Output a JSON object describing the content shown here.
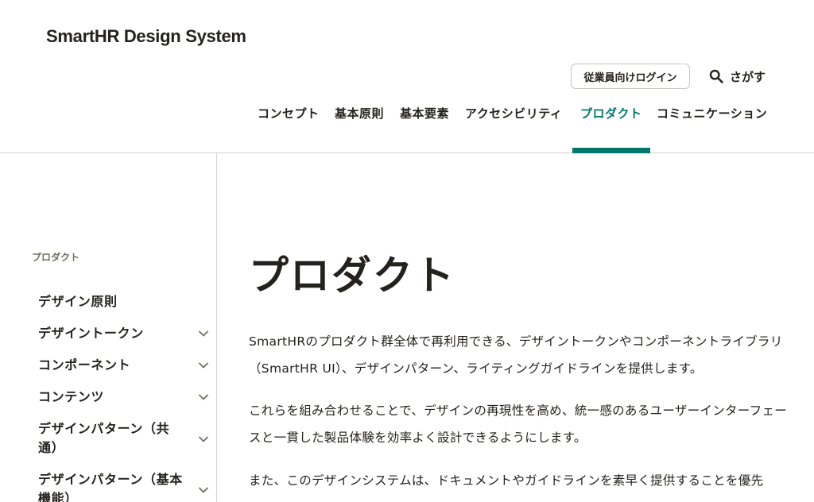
{
  "header": {
    "logo": "SmartHR Design System",
    "login_label": "従業員向けログイン",
    "search_label": "さがす"
  },
  "nav": {
    "items": [
      {
        "label": "コンセプト"
      },
      {
        "label": "基本原則"
      },
      {
        "label": "基本要素"
      },
      {
        "label": "アクセシビリティ"
      },
      {
        "label": "プロダクト"
      },
      {
        "label": "コミュニケーション"
      }
    ],
    "active": "プロダクト"
  },
  "sidebar": {
    "heading": "プロダクト",
    "items": [
      {
        "label": "デザイン原則",
        "expandable": false
      },
      {
        "label": "デザイントークン",
        "expandable": true
      },
      {
        "label": "コンポーネント",
        "expandable": true
      },
      {
        "label": "コンテンツ",
        "expandable": true
      },
      {
        "label": "デザインパターン（共通）",
        "expandable": true
      },
      {
        "label": "デザインパターン（基本機能）",
        "expandable": true
      }
    ]
  },
  "main": {
    "title": "プロダクト",
    "paragraphs": [
      "SmartHRのプロダクト群全体で再利用できる、デザイントークンやコンポーネントライブラリ（SmartHR UI）、デザインパターン、ライティングガイドラインを提供します。",
      "これらを組み合わせることで、デザインの再現性を高め、統一感のあるユーザーインターフェースと一貫した製品体験を効率よく設計できるようにします。",
      "また、このデザインシステムは、ドキュメントやガイドラインを素早く提供することを優先"
    ]
  },
  "colors": {
    "accent": "#00786e",
    "text": "#23221e",
    "muted": "#706d65",
    "border": "#d6d3d0"
  },
  "icons": {
    "search": "search-icon",
    "expand": "chevron-down-icon"
  }
}
